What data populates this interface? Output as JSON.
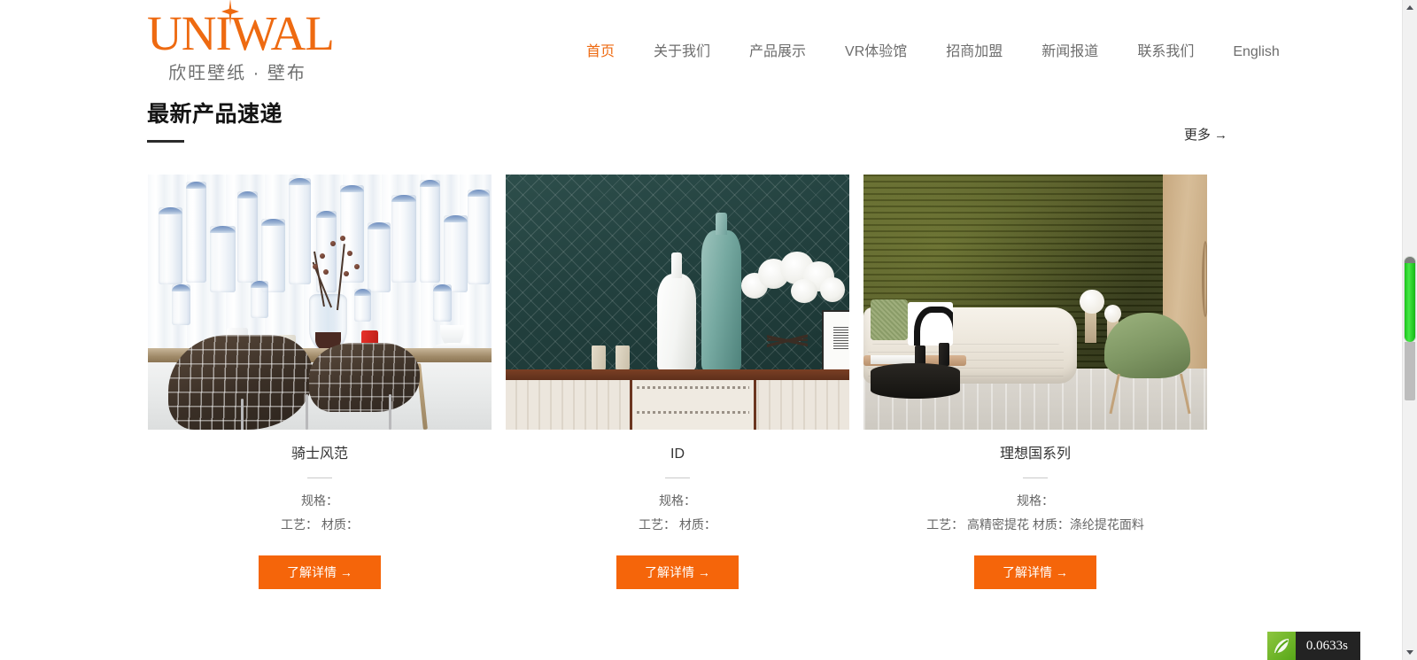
{
  "brand": {
    "logo_text": "UNIWAL",
    "logo_sub": "欣旺壁纸 · 壁布",
    "accent_color": "#ee6a11",
    "button_color": "#f5650a"
  },
  "nav": {
    "items": [
      {
        "label": "首页",
        "active": true
      },
      {
        "label": "关于我们",
        "active": false
      },
      {
        "label": "产品展示",
        "active": false
      },
      {
        "label": "VR体验馆",
        "active": false
      },
      {
        "label": "招商加盟",
        "active": false
      },
      {
        "label": "新闻报道",
        "active": false
      },
      {
        "label": "联系我们",
        "active": false
      },
      {
        "label": "English",
        "active": false
      }
    ]
  },
  "section": {
    "title": "最新产品速递",
    "more_label": "更多 →"
  },
  "products": [
    {
      "title": "骑士风范",
      "spec_label": "规格：",
      "meta": "工艺： 材质：",
      "button_label": "了解详情 →",
      "image_alt": "白色立体圆柱纹壁纸餐厅场景"
    },
    {
      "title": "ID",
      "spec_label": "规格：",
      "meta": "工艺： 材质：",
      "button_label": "了解详情 →",
      "image_alt": "墨绿菱格纹壁纸花瓶场景"
    },
    {
      "title": "理想国系列",
      "spec_label": "规格：",
      "meta": "工艺： 高精密提花 材质：涤纶提花面料",
      "button_label": "了解详情 →",
      "image_alt": "橄榄绿肌理壁布客厅场景"
    }
  ],
  "debug": {
    "time": "0.0633s",
    "icon": "leaf-icon"
  },
  "scrollbar": {
    "up_icon": "chevron-up-icon",
    "down_icon": "chevron-down-icon"
  }
}
